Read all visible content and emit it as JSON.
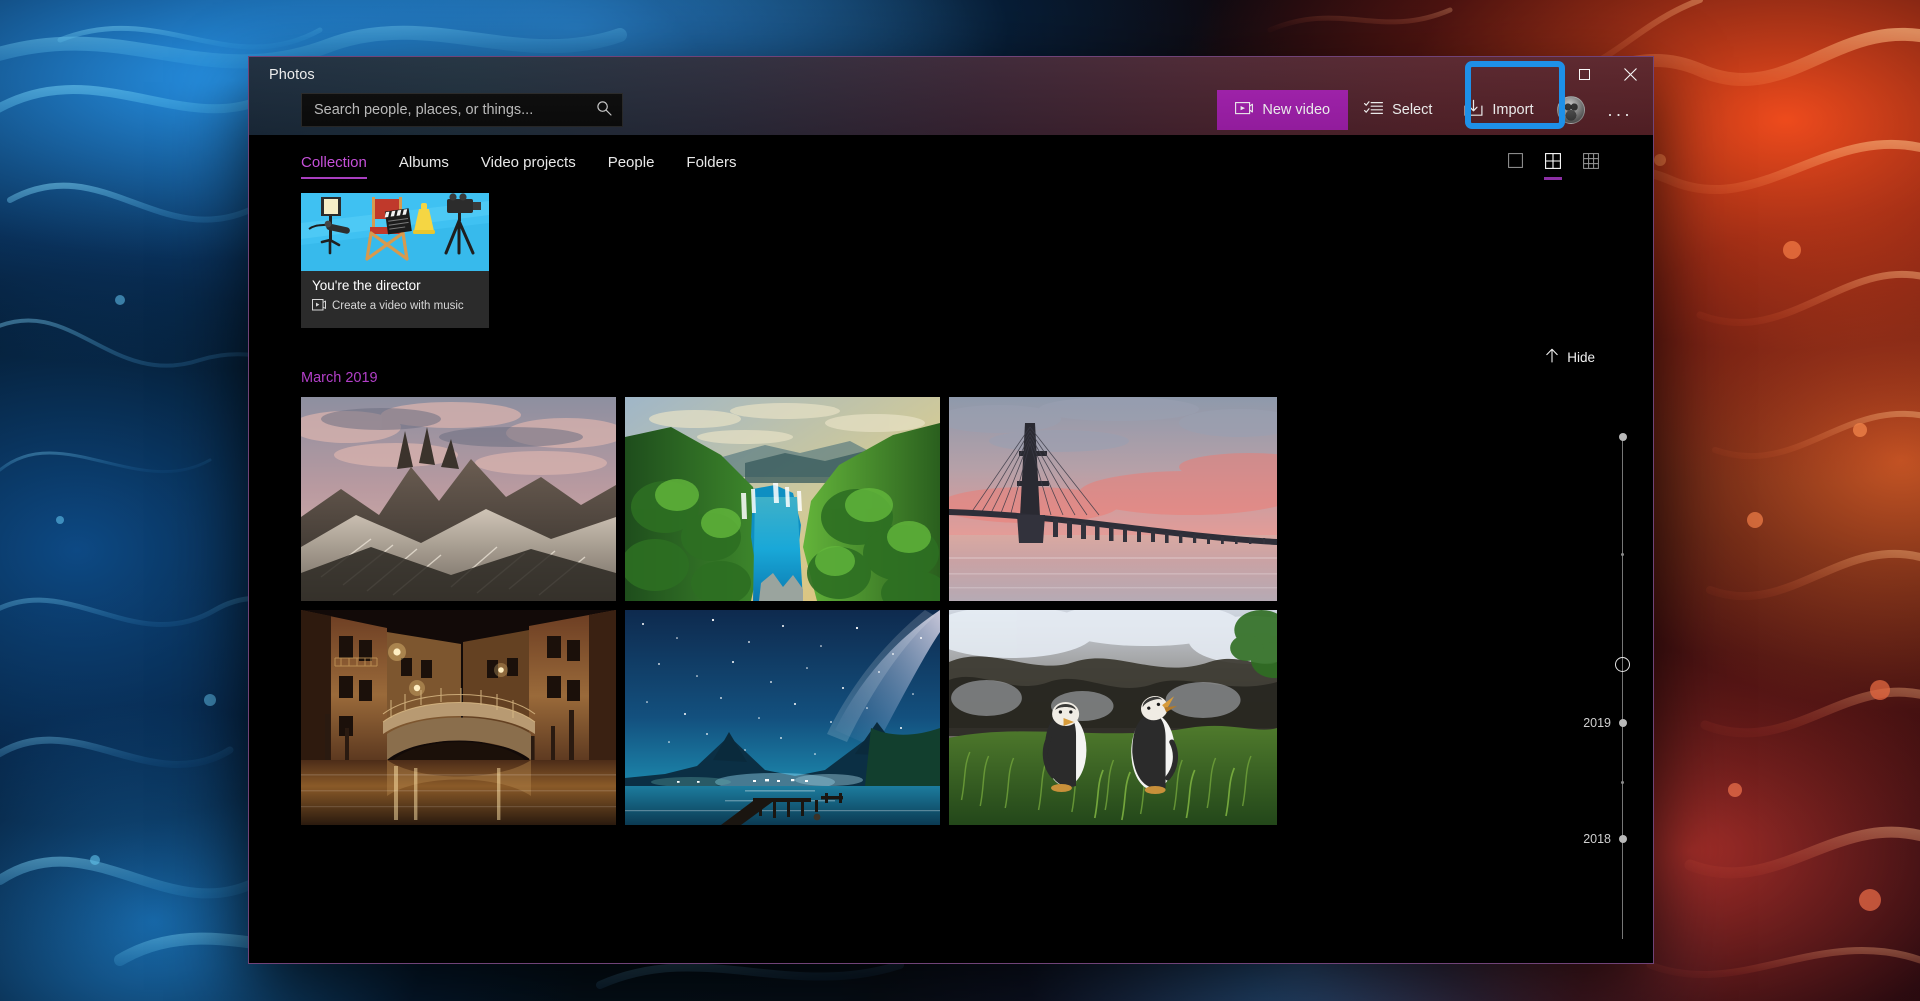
{
  "desktop": {
    "wallpaper_name": "blue-and-orange-ink-smoke-wallpaper",
    "colors": {
      "blue_ink": "#1e90e8",
      "orange_ink": "#ff5a2a",
      "deep_teal": "#04121c"
    }
  },
  "window": {
    "app_title": "Photos",
    "accent": "#a41fb0",
    "highlight_color": "#1e90e8",
    "controls": {
      "maximize_icon": "maximize-square-icon",
      "close_icon": "close-x-icon"
    }
  },
  "search": {
    "placeholder": "Search people, places, or things...",
    "value": "",
    "icon": "search-icon"
  },
  "toolbar": {
    "new_video_label": "New video",
    "new_video_icon": "video-plus-icon",
    "select_label": "Select",
    "select_icon": "checklist-icon",
    "import_label": "Import",
    "import_icon": "import-tray-arrow-icon",
    "avatar": "user-avatar",
    "more_label": "...",
    "more_icon": "more-ellipsis-icon"
  },
  "tabs": [
    {
      "label": "Collection",
      "active": true
    },
    {
      "label": "Albums",
      "active": false
    },
    {
      "label": "Video projects",
      "active": false
    },
    {
      "label": "People",
      "active": false
    },
    {
      "label": "Folders",
      "active": false
    }
  ],
  "view_toggles": [
    {
      "name": "large-view",
      "icon": "single-square-icon",
      "active": false
    },
    {
      "name": "medium-view",
      "icon": "grid-2x2-icon",
      "active": true
    },
    {
      "name": "small-view",
      "icon": "grid-3x3-icon",
      "active": false
    }
  ],
  "director_card": {
    "title": "You're the director",
    "subtitle": "Create a video with music",
    "subtitle_icon": "video-clip-icon",
    "art": "film-set-illustration"
  },
  "hide_button": {
    "label": "Hide",
    "icon": "chevron-up-icon"
  },
  "month_header": "March 2019",
  "photos": [
    {
      "name": "photo-mountain-peaks-sunset",
      "alt": "Jagged mountain peaks under pink sunset clouds"
    },
    {
      "name": "photo-turquoise-lake-canyon",
      "alt": "Turquoise lake and waterfalls in a green forested canyon"
    },
    {
      "name": "photo-cable-bridge-sunset",
      "alt": "Long cable-stayed bridge over calm water at sunset"
    },
    {
      "name": "photo-venice-canal-night",
      "alt": "Venice canal at night with lit stone bridge and reflections"
    },
    {
      "name": "photo-milky-way-lake",
      "alt": "Milky Way over a lake with a wooden pier at night"
    },
    {
      "name": "photo-penguins-grass",
      "alt": "Two penguins calling on grass near a rock face"
    }
  ],
  "timeline": {
    "labels": [
      {
        "text": "2019",
        "pos_pct": 68
      },
      {
        "text": "2018",
        "pos_pct": 99
      }
    ],
    "current_position_pct": 46
  }
}
